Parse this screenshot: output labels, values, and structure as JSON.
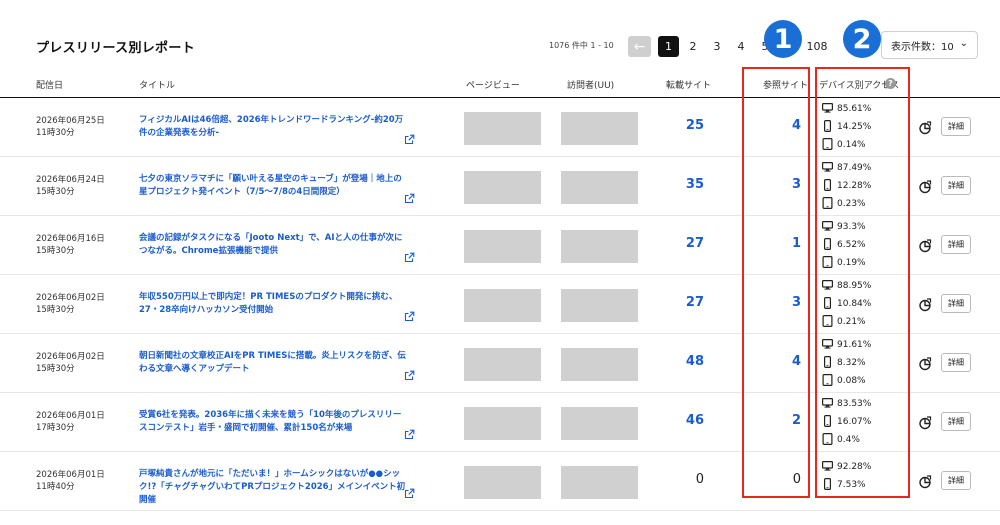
{
  "header": {
    "title": "プレスリリース別レポート",
    "count_text": "1076 件中 1 - 10",
    "pager": {
      "prev": "←",
      "pages": [
        "1",
        "2",
        "3",
        "4",
        "5"
      ],
      "ellipsis": "...",
      "last": "108",
      "next": "→"
    },
    "per_page": "表示件数：10",
    "per_page_chevron": "⌄"
  },
  "columns": {
    "date": "配信日",
    "title": "タイトル",
    "pageview": "ページビュー",
    "visitors": "訪問者(UU)",
    "media": "転載サイト",
    "referrer": "参照サイト",
    "device": "デバイス別アクセス",
    "help": "?"
  },
  "rows": [
    {
      "date": "2026年06月25日",
      "time": "11時30分",
      "title": "フィジカルAIは46倍超、2026年トレンドワードランキング-約20万件の企業発表を分析-",
      "media": "25",
      "referrer": "4",
      "pc": "85.61%",
      "mobile": "14.25%",
      "tablet": "0.14%",
      "detail": "詳細"
    },
    {
      "date": "2026年06月24日",
      "time": "15時30分",
      "title": "七夕の東京ソラマチに「願い叶える星空のキューブ」が登場｜地上の星プロジェクト発イベント（7/5〜7/8の4日間限定）",
      "media": "35",
      "referrer": "3",
      "pc": "87.49%",
      "mobile": "12.28%",
      "tablet": "0.23%",
      "detail": "詳細"
    },
    {
      "date": "2026年06月16日",
      "time": "15時30分",
      "title": "会議の記録がタスクになる「Jooto Next」で、AIと人の仕事が次につながる。Chrome拡張機能で提供",
      "media": "27",
      "referrer": "1",
      "pc": "93.3%",
      "mobile": "6.52%",
      "tablet": "0.19%",
      "detail": "詳細"
    },
    {
      "date": "2026年06月02日",
      "time": "15時30分",
      "title": "年収550万円以上で即内定！PR TIMESのプロダクト開発に挑む、27・28卒向けハッカソン受付開始",
      "media": "27",
      "referrer": "3",
      "pc": "88.95%",
      "mobile": "10.84%",
      "tablet": "0.21%",
      "detail": "詳細"
    },
    {
      "date": "2026年06月02日",
      "time": "15時30分",
      "title": "朝日新聞社の文章校正AIをPR TIMESに搭載。炎上リスクを防ぎ、伝わる文章へ導くアップデート",
      "media": "48",
      "referrer": "4",
      "pc": "91.61%",
      "mobile": "8.32%",
      "tablet": "0.08%",
      "detail": "詳細"
    },
    {
      "date": "2026年06月01日",
      "time": "17時30分",
      "title": "受賞6社を発表。2036年に描く未来を競う「10年後のプレスリリースコンテスト」岩手・盛岡で初開催、累計150名が来場",
      "media": "46",
      "referrer": "2",
      "pc": "83.53%",
      "mobile": "16.07%",
      "tablet": "0.4%",
      "detail": "詳細"
    },
    {
      "date": "2026年06月01日",
      "time": "11時40分",
      "title": "戸塚純貴さんが地元に「ただいま！」ホームシックはないが●●シック!?「チャグチャグいわてPRプロジェクト2026」メインイベント初開催",
      "media": "0",
      "referrer": "0",
      "pc": "92.28%",
      "mobile": "7.53%",
      "tablet": "",
      "detail": "詳細"
    }
  ],
  "annotations": {
    "badge_1": "1",
    "badge_2": "2",
    "box_color": "#e8271e",
    "badge_color": "#1a6fd6"
  },
  "colors": {
    "link": "#1a5cd0",
    "placeholder": "#d0d0d0"
  },
  "icons": {
    "external_link": "external-link-icon",
    "pc": "monitor-icon",
    "mobile": "smartphone-icon",
    "tablet": "tablet-icon",
    "graph": "pie-chart-icon"
  }
}
